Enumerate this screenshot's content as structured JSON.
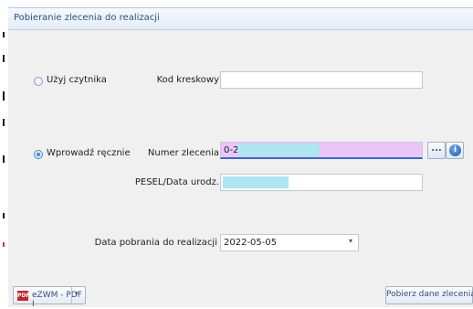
{
  "window": {
    "title": "Pobieranie zlecenia do realizacji"
  },
  "reader": {
    "radio_label": "Użyj czytnika",
    "barcode_label": "Kod kreskowy",
    "barcode_value": ""
  },
  "manual": {
    "radio_label": "Wprowadź ręcznie",
    "order_number_label": "Numer zlecenia",
    "order_number_value": "0-2:",
    "browse_label": "...",
    "info_glyph": "i",
    "pesel_label": "PESEL/Data urodz.",
    "pesel_value": ""
  },
  "date": {
    "label": "Data pobrania do realizacji",
    "value": "2022-05-05",
    "arrow": "▾"
  },
  "footer": {
    "pdf_button_label": "eZWM - PDF I",
    "pdf_icon_text": "PDF",
    "pdf_arrow": "▾",
    "fetch_button_label": "Pobierz dane zlecenia"
  }
}
